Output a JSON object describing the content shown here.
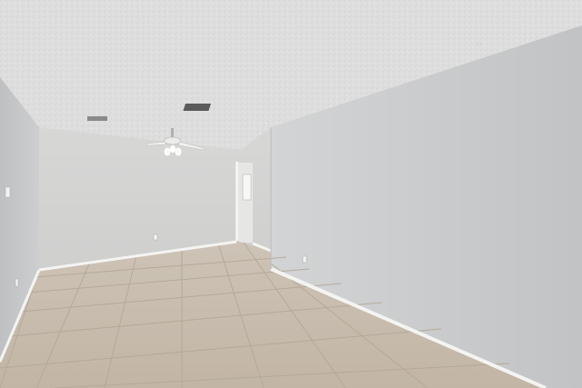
{
  "scene": {
    "description_label": "",
    "colors": {
      "ceiling": "#dcdcda",
      "right_wall": "#cfd0d1",
      "back_wall": "#d3d4d4",
      "left_wall": "#c8c9ca",
      "floor": "#c9beb0",
      "grout": "#b1a595",
      "baseboard": "#f4f4f2",
      "fan": "#f2f2f0"
    }
  }
}
